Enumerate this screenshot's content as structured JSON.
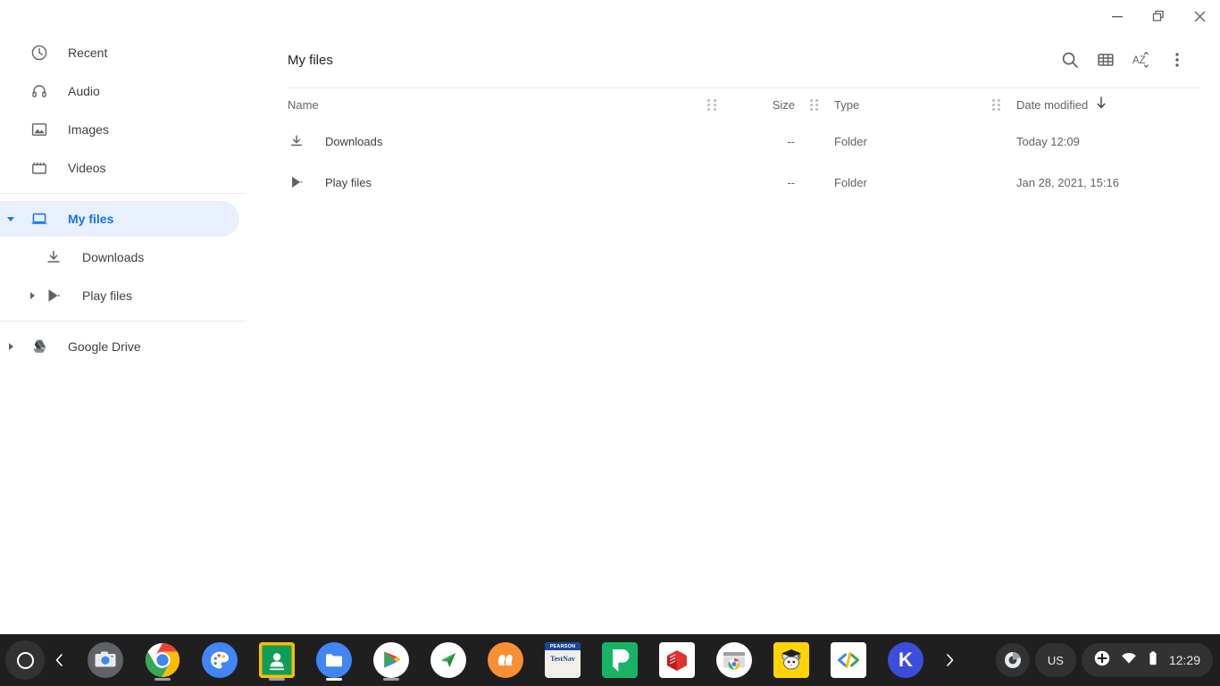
{
  "window": {
    "minimize_label": "Minimize",
    "restore_label": "Restore",
    "close_label": "Close"
  },
  "sidebar": {
    "top_items": [
      {
        "label": "Recent",
        "icon": "clock-icon"
      },
      {
        "label": "Audio",
        "icon": "headphones-icon"
      },
      {
        "label": "Images",
        "icon": "image-icon"
      },
      {
        "label": "Videos",
        "icon": "video-icon"
      }
    ],
    "my_files": {
      "label": "My files",
      "icon": "laptop-icon",
      "selected": true
    },
    "my_files_children": [
      {
        "label": "Downloads",
        "icon": "download-icon"
      },
      {
        "label": "Play files",
        "icon": "play-store-icon"
      }
    ],
    "drive": {
      "label": "Google Drive",
      "icon": "google-drive-icon"
    },
    "selected_color": "#1a73e8",
    "selected_bg": "#e8f0fe"
  },
  "toolbar": {
    "title": "My files",
    "search_label": "Search",
    "view_label": "Switch to grid view",
    "sort_label": "Sort",
    "menu_label": "More actions"
  },
  "table": {
    "columns": {
      "name": "Name",
      "size": "Size",
      "type": "Type",
      "date": "Date modified"
    },
    "sort_column": "Date modified",
    "sort_direction": "descending",
    "rows": [
      {
        "name": "Downloads",
        "icon": "download-icon",
        "size": "--",
        "type": "Folder",
        "date": "Today 12:09"
      },
      {
        "name": "Play files",
        "icon": "play-store-icon",
        "size": "--",
        "type": "Folder",
        "date": "Jan 28, 2021, 15:16"
      }
    ]
  },
  "shelf": {
    "launcher_label": "Launcher",
    "back_label": "Back",
    "forward_label": "Show more apps",
    "apps": [
      {
        "name": "camera-app",
        "label": "Camera",
        "running": false
      },
      {
        "name": "chrome-app",
        "label": "Chrome",
        "running": true
      },
      {
        "name": "canvas-app",
        "label": "Canvas",
        "running": false
      },
      {
        "name": "classroom-app",
        "label": "Google Classroom",
        "running": true
      },
      {
        "name": "files-app",
        "label": "Files",
        "running": true,
        "active": true
      },
      {
        "name": "play-store-app",
        "label": "Play Store",
        "running": true
      },
      {
        "name": "sendit-app",
        "label": "Seesaw",
        "running": false
      },
      {
        "name": "duolingo-app",
        "label": "Duolingo",
        "running": false
      },
      {
        "name": "testnav-app",
        "label": "Pearson TestNav",
        "running": false,
        "text_top": "PEARSON",
        "text_bottom": "TestNav"
      },
      {
        "name": "padlet-app",
        "label": "Padlet",
        "running": false,
        "glyph": "P"
      },
      {
        "name": "sketchup-app",
        "label": "SketchUp",
        "running": false
      },
      {
        "name": "webstore-app",
        "label": "Chrome Web Store",
        "running": false
      },
      {
        "name": "typing-mouse-app",
        "label": "Typing Club",
        "running": false
      },
      {
        "name": "code-app",
        "label": "Code Editor",
        "running": false
      },
      {
        "name": "kami-app",
        "label": "Kami",
        "running": false,
        "glyph": "K"
      }
    ],
    "tray": {
      "capture_label": "Screen capture",
      "keyboard": "US",
      "accessibility_label": "Accessibility",
      "network_label": "Wi-Fi",
      "battery_label": "Battery",
      "time": "12:29"
    }
  }
}
